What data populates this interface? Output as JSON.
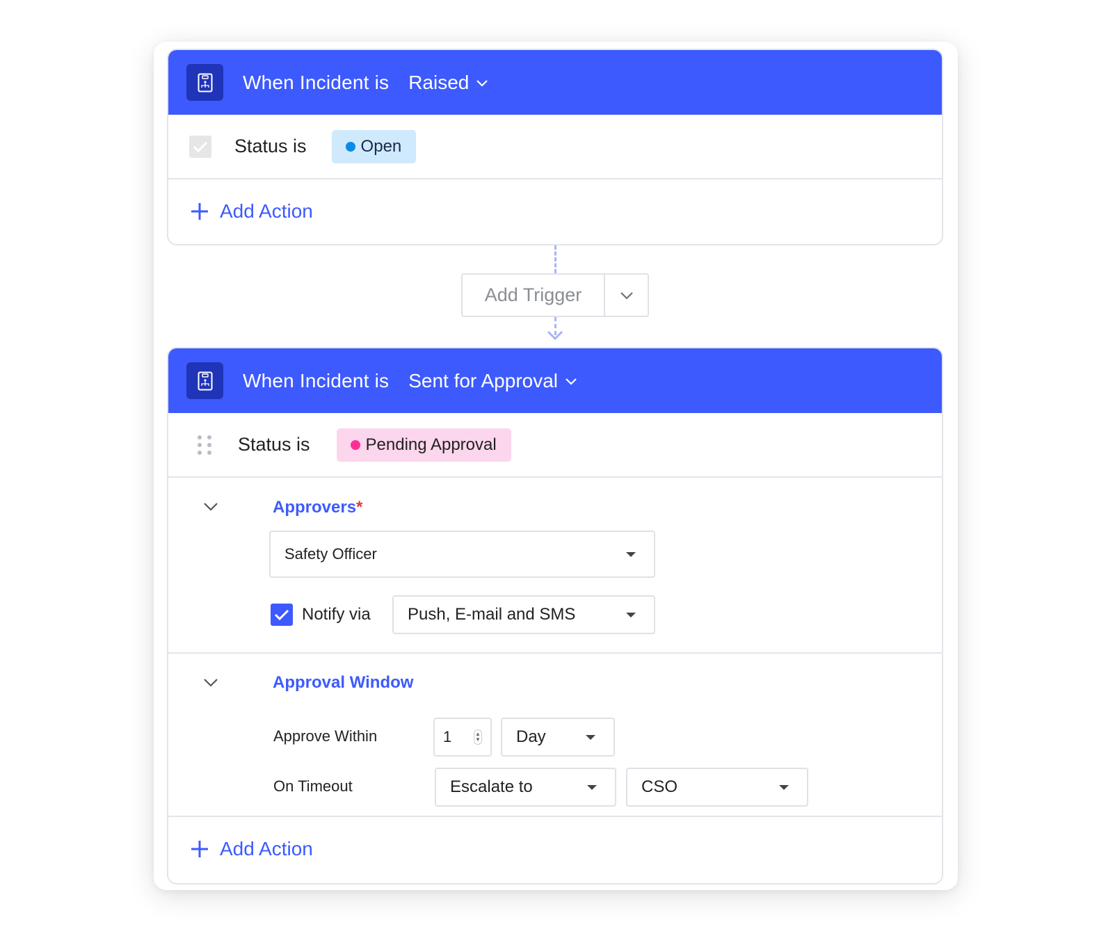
{
  "trigger_card_1": {
    "header_text": "When Incident is",
    "header_value": "Raised",
    "status_label": "Status is",
    "status_chip": "Open",
    "add_action": "Add Action"
  },
  "add_trigger": {
    "label": "Add Trigger"
  },
  "trigger_card_2": {
    "header_text": "When Incident is",
    "header_value": "Sent for Approval",
    "status_label": "Status is",
    "status_chip": "Pending Approval",
    "approvers": {
      "title": "Approvers",
      "required_mark": "*",
      "selected": "Safety Officer",
      "notify_label": "Notify via",
      "notify_checked": true,
      "notify_selected": "Push, E-mail and SMS"
    },
    "approval_window": {
      "title": "Approval Window",
      "approve_within_label": "Approve Within",
      "approve_within_value": "1",
      "approve_within_unit": "Day",
      "on_timeout_label": "On Timeout",
      "on_timeout_action": "Escalate to",
      "on_timeout_target": "CSO"
    },
    "add_action": "Add Action"
  },
  "colors": {
    "accent": "#3d5afe",
    "header_icon_bg": "#1f34b8",
    "open_chip_bg": "#cfeafc",
    "open_dot": "#0b8be6",
    "pending_chip_bg": "#fcd6ec",
    "pending_dot": "#ff2f96",
    "required": "#e53935"
  },
  "icons": {
    "header": "incident-document-icon",
    "dropdown": "chevron-down-icon",
    "add": "plus-icon",
    "collapse": "chevron-down-icon",
    "drag": "drag-handle-icon"
  }
}
